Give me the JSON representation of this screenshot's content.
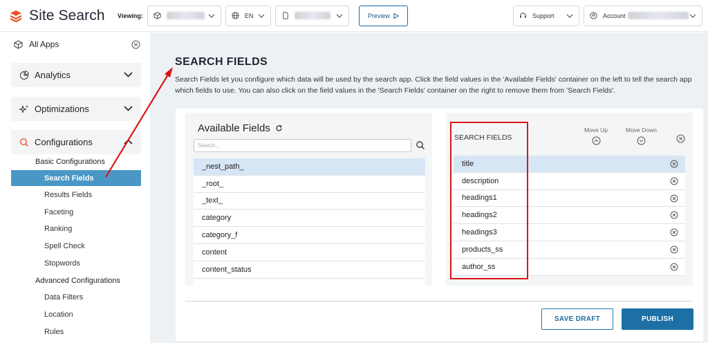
{
  "header": {
    "app_name": "Site Search",
    "viewing_label": "Viewing:",
    "language": "EN",
    "preview_label": "Preview",
    "support_label": "Support",
    "account_label": "Account"
  },
  "sidebar": {
    "all_apps": "All Apps",
    "sections": [
      {
        "label": "Analytics"
      },
      {
        "label": "Optimizations"
      },
      {
        "label": "Configurations"
      }
    ],
    "basic_heading": "Basic Configurations",
    "basic_items": [
      "Search Fields",
      "Results Fields",
      "Faceting",
      "Ranking",
      "Spell Check",
      "Stopwords"
    ],
    "advanced_heading": "Advanced Configurations",
    "advanced_items": [
      "Data Filters",
      "Location",
      "Rules"
    ],
    "active_item": "Search Fields"
  },
  "main": {
    "title": "SEARCH FIELDS",
    "description": "Search Fields let you configure which data will be used by the search app. Click the field values in the 'Available Fields' container on the left to tell the search app which fields to use. You can also click on the field values in the 'Search Fields' container on the right to remove them from 'Search Fields'.",
    "available": {
      "title": "Available Fields",
      "search_placeholder": "Search...",
      "fields": [
        "_nest_path_",
        "_root_",
        "_text_",
        "category",
        "category_f",
        "content",
        "content_status"
      ]
    },
    "search_fields": {
      "title": "SEARCH FIELDS",
      "move_up": "Move Up",
      "move_down": "Move Down",
      "fields": [
        "title",
        "description",
        "headings1",
        "headings2",
        "headings3",
        "products_ss",
        "author_ss"
      ]
    },
    "save_draft": "SAVE DRAFT",
    "publish": "PUBLISH"
  },
  "colors": {
    "brand": "#e8542a",
    "active_nav": "#4a97c6",
    "primary": "#1d70a5",
    "annotation": "#d91515"
  }
}
